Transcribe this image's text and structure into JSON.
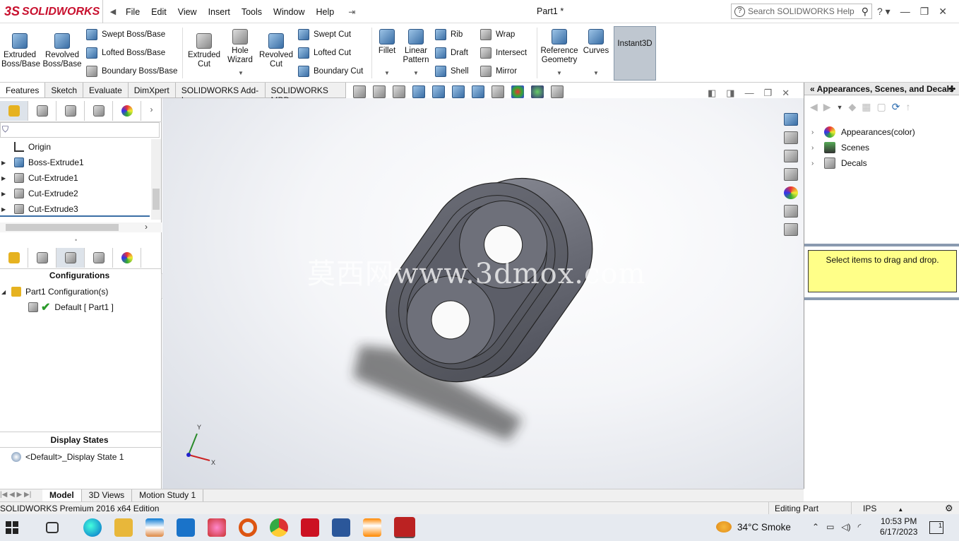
{
  "app": {
    "brand_prefix": "3S",
    "brand_name": "SOLIDWORKS",
    "doc_title": "Part1 *"
  },
  "menu": {
    "items": [
      "File",
      "Edit",
      "View",
      "Insert",
      "Tools",
      "Window",
      "Help"
    ]
  },
  "search": {
    "placeholder": "Search SOLIDWORKS Help"
  },
  "ribbon": {
    "extruded_boss": "Extruded Boss/Base",
    "revolved_boss": "Revolved Boss/Base",
    "swept_boss": "Swept Boss/Base",
    "lofted_boss": "Lofted Boss/Base",
    "boundary_boss": "Boundary Boss/Base",
    "extruded_cut": "Extruded Cut",
    "hole_wizard": "Hole Wizard",
    "revolved_cut": "Revolved Cut",
    "swept_cut": "Swept Cut",
    "lofted_cut": "Lofted Cut",
    "boundary_cut": "Boundary Cut",
    "fillet": "Fillet",
    "linear_pattern": "Linear Pattern",
    "rib": "Rib",
    "draft": "Draft",
    "shell": "Shell",
    "wrap": "Wrap",
    "intersect": "Intersect",
    "mirror": "Mirror",
    "reference_geometry": "Reference Geometry",
    "curves": "Curves",
    "instant3d": "Instant3D"
  },
  "command_tabs": [
    "Features",
    "Sketch",
    "Evaluate",
    "DimXpert",
    "SOLIDWORKS Add-Ins",
    "SOLIDWORKS MBD"
  ],
  "feature_tree": {
    "items": [
      "Origin",
      "Boss-Extrude1",
      "Cut-Extrude1",
      "Cut-Extrude2",
      "Cut-Extrude3"
    ]
  },
  "config": {
    "heading": "Configurations",
    "root": "Part1 Configuration(s)",
    "default": "Default [ Part1 ]"
  },
  "display_states": {
    "heading": "Display States",
    "item": "<Default>_Display State 1"
  },
  "right_panel": {
    "title": "Appearances, Scenes, and Decals",
    "items": [
      "Appearances(color)",
      "Scenes",
      "Decals"
    ],
    "drop_hint": "Select items to drag and drop."
  },
  "bottom_tabs": [
    "Model",
    "3D Views",
    "Motion Study 1"
  ],
  "status": {
    "edition": "SOLIDWORKS Premium 2016 x64 Edition",
    "mode": "Editing Part",
    "units": "IPS"
  },
  "triad": {
    "x": "X",
    "y": "Y"
  },
  "watermark": "莫西网www.3dmox.com",
  "taskbar": {
    "weather": "34°C  Smoke",
    "time": "10:53 PM",
    "date": "6/17/2023",
    "notif_count": "1"
  },
  "colors": {
    "brand_red": "#c8102e",
    "instant3d_bg": "#bfc7d0",
    "drop_hint_bg": "#ffff88"
  }
}
